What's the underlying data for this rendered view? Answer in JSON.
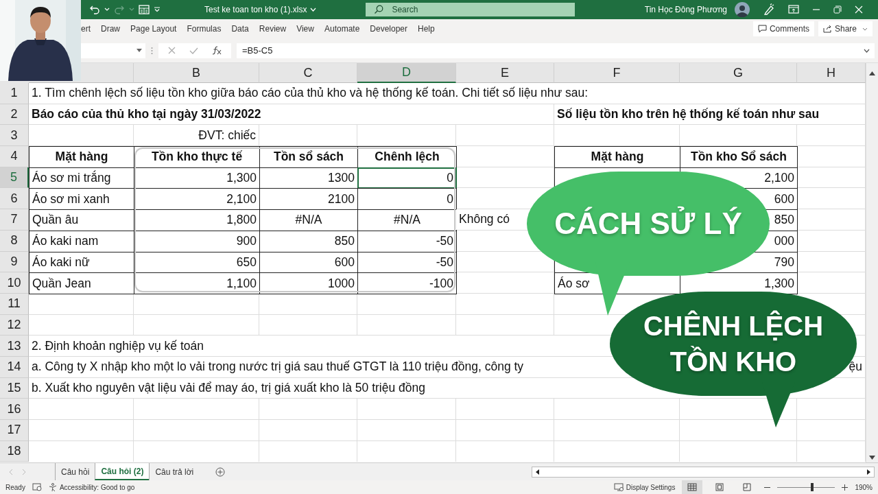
{
  "window": {
    "title": "Test ke toan ton kho (1).xlsx",
    "search_placeholder": "Search",
    "user": "Tin Học Đông Phương"
  },
  "ribbon_tabs": [
    "ert",
    "Draw",
    "Page Layout",
    "Formulas",
    "Data",
    "Review",
    "View",
    "Automate",
    "Developer",
    "Help"
  ],
  "ribbon_buttons": {
    "comments": "Comments",
    "share": "Share"
  },
  "formula_bar": {
    "formula": "=B5-C5"
  },
  "columns": [
    {
      "selected": false
    },
    {
      "label": "B",
      "selected": false
    },
    {
      "label": "C",
      "selected": false
    },
    {
      "label": "D",
      "selected": true
    },
    {
      "label": "E",
      "selected": false
    },
    {
      "label": "F",
      "selected": false
    },
    {
      "label": "G",
      "selected": false
    },
    {
      "label": "H",
      "selected": false
    }
  ],
  "rows": [
    {
      "label": "1",
      "selected": false,
      "cells": {
        "A": {
          "kind": "text",
          "text": "1. Tìm chênh lệch số liệu tồn kho giữa báo cáo của thủ kho và hệ thống kế toán. Chi tiết số liệu như sau:"
        }
      }
    },
    {
      "label": "2",
      "selected": false,
      "cells": {
        "A": {
          "kind": "title",
          "text": "Báo cáo của thủ kho tại ngày 31/03/2022"
        },
        "F": {
          "kind": "title",
          "text": "Số liệu tồn kho trên hệ thống kế toán như sau"
        }
      }
    },
    {
      "label": "3",
      "selected": false,
      "cells": {
        "B": {
          "kind": "note",
          "text": "ĐVT: chiếc"
        }
      }
    },
    {
      "label": "4",
      "selected": false,
      "cells": {
        "A": {
          "kind": "table-header",
          "text": "Mặt hàng"
        },
        "B": {
          "kind": "table-header",
          "text": "Tồn kho thực tế"
        },
        "C": {
          "kind": "table-header",
          "text": "Tồn sổ sách"
        },
        "D": {
          "kind": "table-header",
          "text": "Chênh lệch"
        },
        "F": {
          "kind": "table-header",
          "text": "Mặt hàng"
        },
        "G": {
          "kind": "table-header",
          "text": "Tồn kho Sổ sách"
        }
      }
    },
    {
      "label": "5",
      "selected": true,
      "cells": {
        "A": {
          "kind": "table-text",
          "text": "Áo sơ mi trắng"
        },
        "B": {
          "kind": "table-number",
          "text": "1,300"
        },
        "C": {
          "kind": "table-number",
          "text": "1300"
        },
        "D": {
          "kind": "table-number",
          "text": "0"
        },
        "F": {
          "kind": "table-empty"
        },
        "G": {
          "kind": "table-number",
          "text": "2,100"
        }
      }
    },
    {
      "label": "6",
      "selected": false,
      "cells": {
        "A": {
          "kind": "table-text",
          "text": "Áo sơ mi xanh"
        },
        "B": {
          "kind": "table-number",
          "text": "2,100"
        },
        "C": {
          "kind": "table-number",
          "text": "2100"
        },
        "D": {
          "kind": "table-number",
          "text": "0"
        },
        "G": {
          "kind": "table-number",
          "text": "600"
        }
      }
    },
    {
      "label": "7",
      "selected": false,
      "cells": {
        "A": {
          "kind": "table-text",
          "text": "Quần âu"
        },
        "B": {
          "kind": "table-number",
          "text": "1,800"
        },
        "C": {
          "kind": "table-center",
          "text": "#N/A"
        },
        "D": {
          "kind": "table-center",
          "text": "#N/A"
        },
        "E": {
          "kind": "text",
          "text": "Không có"
        },
        "G": {
          "kind": "table-number",
          "text": "850"
        }
      }
    },
    {
      "label": "8",
      "selected": false,
      "cells": {
        "A": {
          "kind": "table-text",
          "text": "Áo kaki nam"
        },
        "B": {
          "kind": "table-number",
          "text": "900"
        },
        "C": {
          "kind": "table-number",
          "text": "850"
        },
        "D": {
          "kind": "table-number",
          "text": "-50"
        },
        "G": {
          "kind": "table-number",
          "text": "000"
        }
      }
    },
    {
      "label": "9",
      "selected": false,
      "cells": {
        "A": {
          "kind": "table-text",
          "text": "Áo kaki nữ"
        },
        "B": {
          "kind": "table-number",
          "text": "650"
        },
        "C": {
          "kind": "table-number",
          "text": "600"
        },
        "D": {
          "kind": "table-number",
          "text": "-50"
        },
        "F": {
          "kind": "table-empty"
        },
        "G": {
          "kind": "table-number",
          "text": "790"
        }
      }
    },
    {
      "label": "10",
      "selected": false,
      "cells": {
        "A": {
          "kind": "table-text",
          "text": "Quần Jean"
        },
        "B": {
          "kind": "table-number",
          "text": "1,100"
        },
        "C": {
          "kind": "table-number",
          "text": "1000"
        },
        "D": {
          "kind": "table-number",
          "text": "-100"
        },
        "F": {
          "kind": "table-text",
          "text": "Áo sơ"
        },
        "G": {
          "kind": "table-number",
          "text": "1,300"
        }
      }
    },
    {
      "label": "11",
      "selected": false,
      "cells": {}
    },
    {
      "label": "12",
      "selected": false,
      "cells": {}
    },
    {
      "label": "13",
      "selected": false,
      "cells": {
        "A": {
          "kind": "text",
          "text": "2. Định khoản nghiệp vụ kế toán"
        }
      }
    },
    {
      "label": "14",
      "selected": false,
      "cells": {
        "A": {
          "kind": "text",
          "text": "a. Công ty X nhập kho một lo vải trong nước trị giá sau thuế GTGT là 110 triệu đồng, công ty"
        },
        "H": {
          "kind": "note",
          "text": "ệu"
        }
      }
    },
    {
      "label": "15",
      "selected": false,
      "cells": {
        "A": {
          "kind": "text",
          "text": "b. Xuất kho nguyên vật liệu vải để may áo, trị giá xuất kho là 50 triệu đồng"
        }
      }
    },
    {
      "label": "16",
      "selected": false,
      "cells": {}
    },
    {
      "label": "17",
      "selected": false,
      "cells": {}
    },
    {
      "label": "18",
      "selected": false,
      "cells": {}
    }
  ],
  "sheet_tabs": [
    {
      "label": "Câu hỏi",
      "selected": false
    },
    {
      "label": "Câu hỏi (2)",
      "selected": true
    },
    {
      "label": "Câu trả lời",
      "selected": false
    }
  ],
  "status_bar": {
    "ready": "Ready",
    "accessibility": "Accessibility: Good to go",
    "display_settings": "Display Settings",
    "zoom": "190%",
    "zoom_slider": {
      "level": 0.6
    }
  },
  "bubbles": [
    {
      "text": "CÁCH SỬ LÝ",
      "color": "#45bf68"
    },
    {
      "text": "CHÊNH LỆCH TỒN KHO",
      "color": "#166b35"
    }
  ]
}
